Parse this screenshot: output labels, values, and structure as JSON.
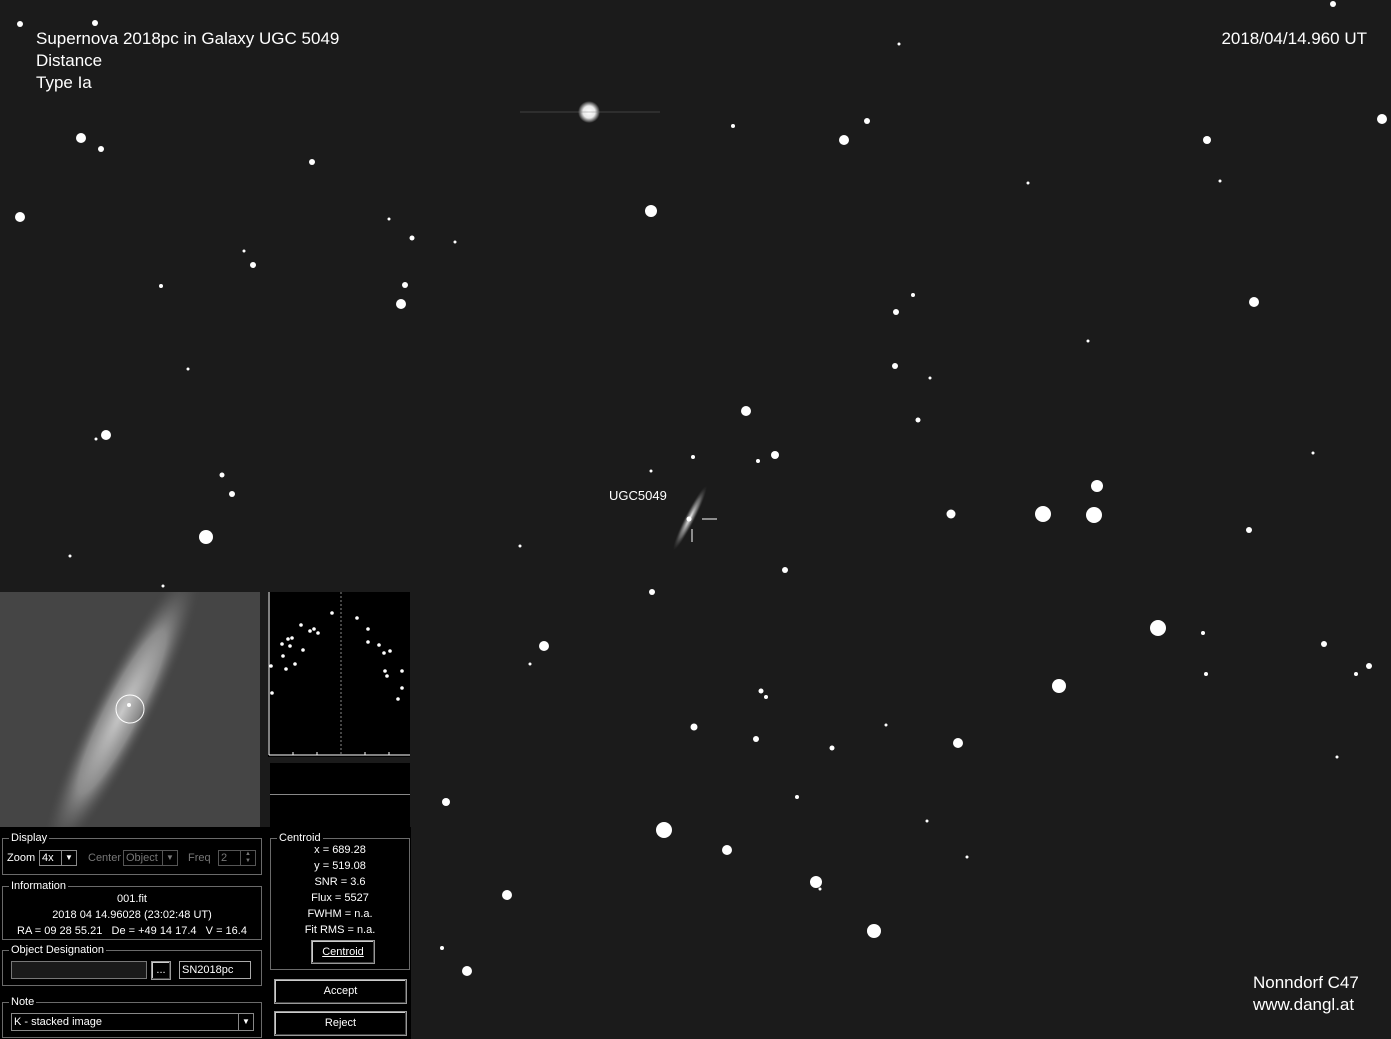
{
  "overlay": {
    "title_line1": "Supernova 2018pc in Galaxy UGC 5049",
    "title_line2": "Distance",
    "title_line3": "Type Ia",
    "timestamp": "2018/04/14.960 UT",
    "galaxy_label": "UGC5049",
    "credit_line1": "Nonndorf C47",
    "credit_line2": "www.dangl.at"
  },
  "display": {
    "group_title": "Display",
    "zoom_label": "Zoom",
    "zoom_value": "4x",
    "center_label": "Center",
    "center_value": "Object",
    "freq_label": "Freq",
    "freq_value": "2"
  },
  "information": {
    "group_title": "Information",
    "filename": "001.fit",
    "datetime": "2018 04 14.96028 (23:02:48 UT)",
    "coords": "RA = 09 28 55.21   De = +49 14 17.4   V = 16.4"
  },
  "object_designation": {
    "group_title": "Object Designation",
    "browse_label": "...",
    "designation_value": "SN2018pc"
  },
  "note": {
    "group_title": "Note",
    "value": "K - stacked image"
  },
  "centroid": {
    "group_title": "Centroid",
    "x": "x = 689.28",
    "y": "y = 519.08",
    "snr": "SNR = 3.6",
    "flux": "Flux = 5527",
    "fwhm": "FWHM = n.a.",
    "fit_rms": "Fit RMS = n.a.",
    "button_label": "Centroid"
  },
  "actions": {
    "accept_label": "Accept",
    "reject_label": "Reject"
  },
  "colors": {
    "sky": "#1b1b1b",
    "panel": "#000000",
    "text": "#ffffff"
  }
}
